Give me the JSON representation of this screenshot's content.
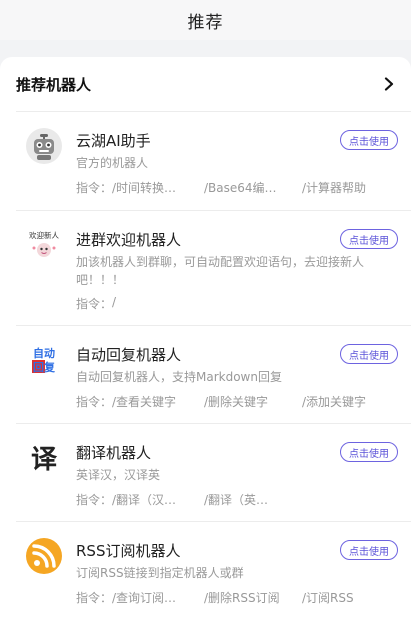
{
  "header": {
    "title": "推荐"
  },
  "section": {
    "title": "推荐机器人"
  },
  "use_label": "点击使用",
  "cmd_prefix": "指令：",
  "robots": [
    {
      "name": "云湖AI助手",
      "desc": "官方的机器人",
      "cmds": [
        "/时间转换…",
        "/Base64编…",
        "/计算器帮助"
      ]
    },
    {
      "name": "进群欢迎机器人",
      "desc": "加该机器人到群聊，可自动配置欢迎语句，去迎接新人吧！！！",
      "cmds": [
        "/"
      ],
      "avatar_text": "欢迎新人"
    },
    {
      "name": "自动回复机器人",
      "desc": "自动回复机器人，支持Markdown回复",
      "cmds": [
        "/查看关键字",
        "/删除关键字",
        "/添加关键字"
      ],
      "avatar_text_top": "自动",
      "avatar_text_bottom": "回复"
    },
    {
      "name": "翻译机器人",
      "desc": "英译汉，汉译英",
      "cmds": [
        "/翻译（汉…",
        "/翻译（英…"
      ],
      "avatar_text": "译"
    },
    {
      "name": "RSS订阅机器人",
      "desc": "订阅RSS链接到指定机器人或群",
      "cmds": [
        "/查询订阅…",
        "/删除RSS订阅",
        "/订阅RSS"
      ]
    }
  ],
  "colors": {
    "accent": "#5b52d8",
    "rss_orange": "#f5a623",
    "auto_blue": "#2f6fe4",
    "auto_red": "#e0302f"
  }
}
